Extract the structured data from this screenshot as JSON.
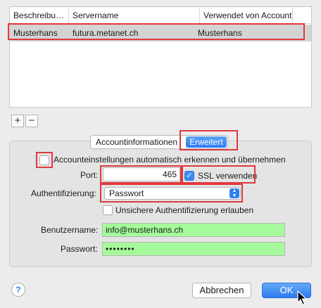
{
  "accounts_table": {
    "columns": [
      "Beschreibu…",
      "Servername",
      "Verwendet von Account"
    ],
    "rows": [
      {
        "description": "Musterhans",
        "server": "futura.metanet.ch",
        "used_by": "Musterhans"
      }
    ]
  },
  "list_controls": {
    "add": "+",
    "remove": "−"
  },
  "tabs": [
    "Accountinformationen",
    "Erweitert"
  ],
  "settings": {
    "auto_detect_label": "Accounteinstellungen automatisch erkennen und übernehmen",
    "auto_detect_checked": false,
    "port_label": "Port:",
    "port_value": "465",
    "ssl_label": "SSL verwenden",
    "ssl_checked": true,
    "auth_label": "Authentifizierung:",
    "auth_value": "Passwort",
    "insecure_label": "Unsichere Authentifizierung erlauben",
    "insecure_checked": false,
    "username_label": "Benutzername:",
    "username_value": "info@musterhans.ch",
    "password_label": "Passwort:",
    "password_value": "••••••••"
  },
  "footer": {
    "help": "?",
    "cancel": "Abbrechen",
    "ok": "OK"
  },
  "colors": {
    "highlight": "#e0393e",
    "accent": "#2f7ef0",
    "filled_field": "#a5fb9b"
  }
}
